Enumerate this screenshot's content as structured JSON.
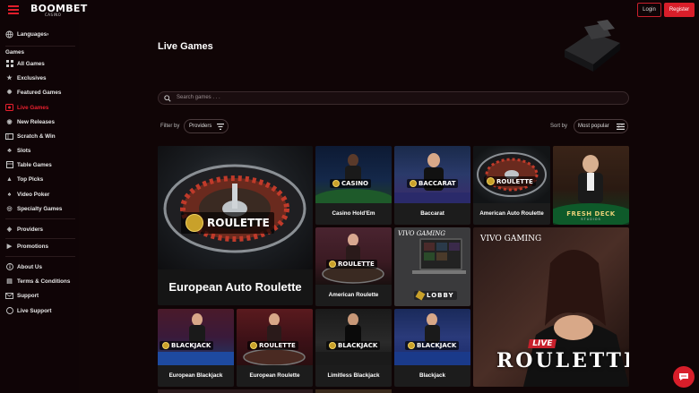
{
  "header": {
    "logo": "BOOMBET",
    "logo_sub": "CASINO",
    "login_label": "Login",
    "register_label": "Register"
  },
  "sidebar": {
    "languages": "Languages",
    "games_heading": "Games",
    "items": [
      {
        "label": "All Games",
        "icon": "grid-icon"
      },
      {
        "label": "Exclusives",
        "icon": "star-icon"
      },
      {
        "label": "Featured Games",
        "icon": "gear-icon"
      },
      {
        "label": "Live Games",
        "icon": "live-icon"
      },
      {
        "label": "New Releases",
        "icon": "bell-icon"
      },
      {
        "label": "Scratch & Win",
        "icon": "ticket-icon"
      },
      {
        "label": "Slots",
        "icon": "cherry-icon"
      },
      {
        "label": "Table Games",
        "icon": "table-icon"
      },
      {
        "label": "Top Picks",
        "icon": "thumb-icon"
      },
      {
        "label": "Video Poker",
        "icon": "cards-icon"
      },
      {
        "label": "Specialty Games",
        "icon": "globe-icon"
      }
    ],
    "providers": "Providers",
    "promotions": "Promotions",
    "about": "About Us",
    "terms": "Terms & Conditions",
    "support": "Support",
    "live_support": "Live Support"
  },
  "main": {
    "title": "Live Games",
    "search_placeholder": "Search games . . .",
    "filter_label": "Filter by",
    "providers_label": "Providers",
    "sort_label": "Sort by",
    "sort_value": "Most popular"
  },
  "tiles": {
    "eur_auto": {
      "caption": "European Auto Roulette",
      "badge": "ROULETTE"
    },
    "casino_holdem": {
      "caption": "Casino Hold'Em",
      "badge": "CASINO"
    },
    "baccarat": {
      "caption": "Baccarat",
      "badge": "BACCARAT"
    },
    "american_auto": {
      "caption": "American Auto Roulette",
      "badge": "ROULETTE"
    },
    "fresh_deck": {
      "logo": "FRESH DECK",
      "logo_sub": "STUDIOS"
    },
    "american_roulette": {
      "caption": "American Roulette",
      "badge": "ROULETTE"
    },
    "lobby": {
      "logo": "VIVO GAMING",
      "badge": "LOBBY"
    },
    "vivo_live": {
      "logo": "VIVO GAMING",
      "live": "LIVE",
      "title": "ROULETTE"
    },
    "eur_blackjack": {
      "caption": "European Blackjack",
      "badge": "BLACKJACK"
    },
    "eur_roulette": {
      "caption": "European Roulette",
      "badge": "ROULETTE"
    },
    "limitless_blackjack": {
      "caption": "Limitless Blackjack",
      "badge": "BLACKJACK"
    },
    "blackjack": {
      "caption": "Blackjack",
      "badge": "BLACKJACK"
    }
  },
  "colors": {
    "accent": "#d81e2a",
    "background": "#100506",
    "caption_bg": "#1c1c1c"
  }
}
